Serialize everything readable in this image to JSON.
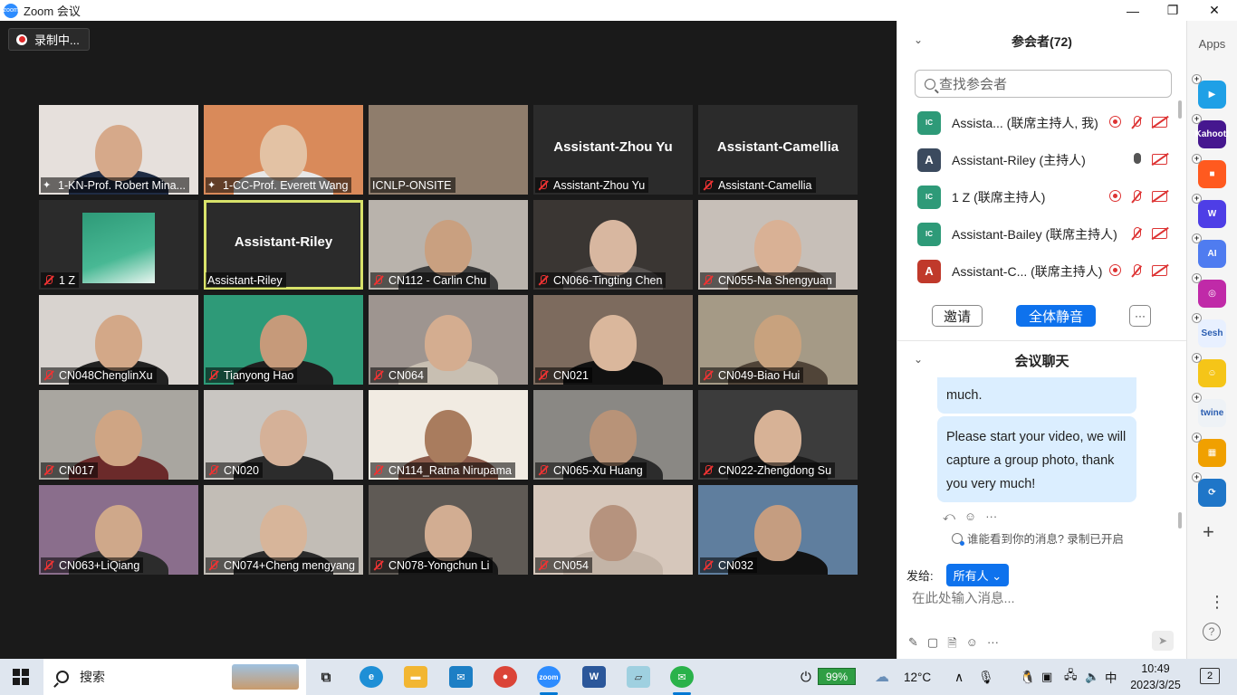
{
  "window": {
    "title": "Zoom 会议",
    "minimize": "—",
    "restore": "❐",
    "close": "✕"
  },
  "recording": {
    "label": "录制中..."
  },
  "tiles": [
    {
      "label": "1-KN-Prof. Robert Mina...",
      "pinned": true,
      "muted": false,
      "bg": "#e6e0dc",
      "skin": "#d6a98a",
      "shirt": "#1f2c44",
      "big": ""
    },
    {
      "label": "1-CC-Prof. Everett Wang",
      "pinned": true,
      "muted": false,
      "bg": "#d98a5a",
      "skin": "#e3c2a4",
      "shirt": "#e8e8e8",
      "big": ""
    },
    {
      "label": "ICNLP-ONSITE",
      "pinned": false,
      "muted": false,
      "bg": "#8f7d6c",
      "skin": "",
      "shirt": "",
      "big": ""
    },
    {
      "label": "Assistant-Zhou Yu",
      "pinned": false,
      "muted": true,
      "bg": "#2b2b2b",
      "skin": "",
      "shirt": "",
      "big": "Assistant-Zhou Yu"
    },
    {
      "label": "Assistant-Camellia",
      "pinned": false,
      "muted": true,
      "bg": "#2b2b2b",
      "skin": "",
      "shirt": "",
      "big": "Assistant-Camellia"
    },
    {
      "label": "1 Z",
      "pinned": false,
      "muted": true,
      "bg": "#2b2b2b",
      "skin": "",
      "shirt": "",
      "big": "",
      "slide": true
    },
    {
      "label": "Assistant-Riley",
      "pinned": false,
      "muted": false,
      "bg": "#2b2b2b",
      "skin": "",
      "shirt": "",
      "big": "Assistant-Riley",
      "active": true
    },
    {
      "label": "CN112 - Carlin Chu",
      "pinned": false,
      "muted": true,
      "bg": "#b9b3ac",
      "skin": "#c9a080",
      "shirt": "#3c3c3c",
      "big": ""
    },
    {
      "label": "CN066-Tingting Chen",
      "pinned": false,
      "muted": true,
      "bg": "#3a3633",
      "skin": "#d8b7a0",
      "shirt": "#5a5654",
      "big": ""
    },
    {
      "label": "CN055-Na Shengyuan",
      "pinned": false,
      "muted": true,
      "bg": "#c7bfb8",
      "skin": "#d9b195",
      "shirt": "#7a6a5e",
      "big": ""
    },
    {
      "label": "CN048ChenglinXu",
      "pinned": false,
      "muted": true,
      "bg": "#d8d3cf",
      "skin": "#d3a888",
      "shirt": "#222",
      "big": ""
    },
    {
      "label": "Tianyong Hao",
      "pinned": false,
      "muted": true,
      "bg": "#2e9a78",
      "skin": "#c69a7a",
      "shirt": "#1f1f1f",
      "big": ""
    },
    {
      "label": "CN064",
      "pinned": false,
      "muted": true,
      "bg": "#9e9590",
      "skin": "#d4ad90",
      "shirt": "#c8bfb2",
      "big": ""
    },
    {
      "label": "CN021",
      "pinned": false,
      "muted": true,
      "bg": "#7d6b5e",
      "skin": "#dab79c",
      "shirt": "#111",
      "big": ""
    },
    {
      "label": "CN049-Biao Hui",
      "pinned": false,
      "muted": true,
      "bg": "#a59a86",
      "skin": "#c8a27e",
      "shirt": "#504438",
      "big": ""
    },
    {
      "label": "CN017",
      "pinned": false,
      "muted": true,
      "bg": "#a9a6a0",
      "skin": "#cfa584",
      "shirt": "#6b2a2a",
      "big": ""
    },
    {
      "label": "CN020",
      "pinned": false,
      "muted": true,
      "bg": "#c9c6c2",
      "skin": "#d5b198",
      "shirt": "#2c2c2c",
      "big": ""
    },
    {
      "label": "CN114_Ratna Nirupama",
      "pinned": false,
      "muted": true,
      "bg": "#f1ebe2",
      "skin": "#a97c5e",
      "shirt": "#8b5a4a",
      "big": ""
    },
    {
      "label": "CN065-Xu Huang",
      "pinned": false,
      "muted": true,
      "bg": "#8a8884",
      "skin": "#b89378",
      "shirt": "#2c2c2c",
      "big": ""
    },
    {
      "label": "CN022-Zhengdong Su",
      "pinned": false,
      "muted": true,
      "bg": "#3c3c3c",
      "skin": "#d7b296",
      "shirt": "#1d1d1d",
      "big": ""
    },
    {
      "label": "CN063+LiQiang",
      "pinned": false,
      "muted": true,
      "bg": "#8a6e8c",
      "skin": "#cfa88a",
      "shirt": "#2c2c2c",
      "big": ""
    },
    {
      "label": "CN074+Cheng mengyang",
      "pinned": false,
      "muted": true,
      "bg": "#c2bdb6",
      "skin": "#d7b59a",
      "shirt": "#2b2b2b",
      "big": ""
    },
    {
      "label": "CN078-Yongchun Li",
      "pinned": false,
      "muted": true,
      "bg": "#5f5a55",
      "skin": "#d2ad92",
      "shirt": "#181818",
      "big": ""
    },
    {
      "label": "CN054",
      "pinned": false,
      "muted": true,
      "bg": "#d6c7bb",
      "skin": "#b6937e",
      "shirt": "#c3b4a7",
      "big": ""
    },
    {
      "label": "CN032",
      "pinned": false,
      "muted": true,
      "bg": "#5f7e9e",
      "skin": "#c59d80",
      "shirt": "#121212",
      "big": ""
    }
  ],
  "participants": {
    "title": "参会者(72)",
    "search_placeholder": "查找参会者",
    "list": [
      {
        "initial": "IC",
        "name": "Assista...  (联席主持人, 我)",
        "avatar_color": "#2e9a78",
        "rec": true,
        "mic_on": false
      },
      {
        "initial": "A",
        "name": "Assistant-Riley (主持人)",
        "avatar_color": "#3b4a5e",
        "rec": false,
        "mic_on": true
      },
      {
        "initial": "IC",
        "name": "1 Z (联席主持人)",
        "avatar_color": "#2e9a78",
        "rec": true,
        "mic_on": false
      },
      {
        "initial": "IC",
        "name": "Assistant-Bailey (联席主持人)",
        "avatar_color": "#2e9a78",
        "rec": false,
        "mic_on": false
      },
      {
        "initial": "A",
        "name": "Assistant-C...  (联席主持人)",
        "avatar_color": "#c0392b",
        "rec": true,
        "mic_on": false
      }
    ],
    "invite": "邀请",
    "mute_all": "全体静音",
    "more": "···"
  },
  "chat": {
    "title": "会议聊天",
    "prev_fragment": "much.",
    "message": "Please start your video, we will capture a group photo, thank you very much!",
    "visibility": "谁能看到你的消息? 录制已开启",
    "send_to_label": "发给:",
    "send_to_value": "所有人",
    "input_placeholder": "在此处输入消息..."
  },
  "apps": {
    "title": "Apps",
    "items": [
      {
        "name": "pear-deck-app",
        "text": "▶",
        "color": "#1fa0e6"
      },
      {
        "name": "kahoot-app",
        "text": "Kahoot!",
        "color": "#46178f"
      },
      {
        "name": "claap-app",
        "text": "■",
        "color": "#ff5a1f"
      },
      {
        "name": "wooclap-app",
        "text": "W",
        "color": "#4e3ee6"
      },
      {
        "name": "ai-assistant-app",
        "text": "AI",
        "color": "#4f7cf0"
      },
      {
        "name": "video-app",
        "text": "◎",
        "color": "#c02aa8"
      },
      {
        "name": "sesh-app",
        "text": "Sesh",
        "color": "#e8f0ff"
      },
      {
        "name": "smile-app",
        "text": "☺",
        "color": "#f5c518"
      },
      {
        "name": "twine-app",
        "text": "twine",
        "color": "#eef2f6"
      },
      {
        "name": "grid-app",
        "text": "▦",
        "color": "#f0a000"
      },
      {
        "name": "sync-app",
        "text": "⟳",
        "color": "#1f76c8"
      }
    ]
  },
  "taskbar": {
    "search": "搜索",
    "battery": "99%",
    "weather": "12°C",
    "ime": "中",
    "time": "10:49",
    "date": "2023/3/25",
    "notifications": "2"
  }
}
